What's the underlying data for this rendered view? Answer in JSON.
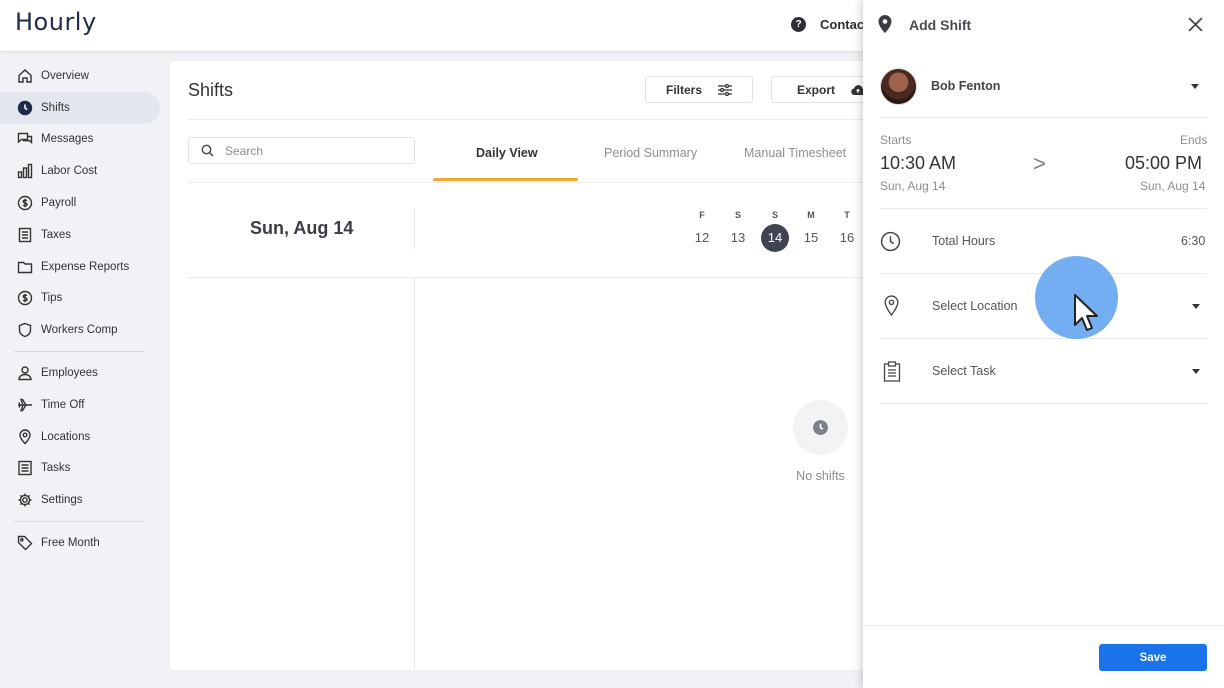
{
  "app": {
    "logo": "Hourly"
  },
  "topbar": {
    "help_icon": "?",
    "contact_label": "Contact"
  },
  "sidebar": {
    "items": [
      {
        "label": "Overview",
        "icon": "home-icon"
      },
      {
        "label": "Shifts",
        "icon": "clock-icon",
        "active": true
      },
      {
        "label": "Messages",
        "icon": "chat-icon"
      },
      {
        "label": "Labor Cost",
        "icon": "bar-chart-icon"
      },
      {
        "label": "Payroll",
        "icon": "dollar-icon"
      },
      {
        "label": "Taxes",
        "icon": "document-icon"
      },
      {
        "label": "Expense Reports",
        "icon": "folder-icon"
      },
      {
        "label": "Tips",
        "icon": "dollar-icon"
      },
      {
        "label": "Workers Comp",
        "icon": "shield-icon"
      },
      {
        "label": "Employees",
        "icon": "person-icon"
      },
      {
        "label": "Time Off",
        "icon": "plane-icon"
      },
      {
        "label": "Locations",
        "icon": "pin-icon"
      },
      {
        "label": "Tasks",
        "icon": "list-icon"
      },
      {
        "label": "Settings",
        "icon": "gear-icon"
      },
      {
        "label": "Free Month",
        "icon": "tag-icon"
      }
    ]
  },
  "main": {
    "title": "Shifts",
    "filters_label": "Filters",
    "export_label": "Export",
    "search_placeholder": "Search",
    "tabs": [
      {
        "label": "Daily View",
        "active": true
      },
      {
        "label": "Period Summary"
      },
      {
        "label": "Manual Timesheet"
      }
    ],
    "selected_date": "Sun, Aug 14",
    "week_days": [
      {
        "letter": "F",
        "num": "12"
      },
      {
        "letter": "S",
        "num": "13"
      },
      {
        "letter": "S",
        "num": "14",
        "selected": true
      },
      {
        "letter": "M",
        "num": "15"
      },
      {
        "letter": "T",
        "num": "16"
      }
    ],
    "empty_text": "No shifts"
  },
  "drawer": {
    "title": "Add Shift",
    "employee": "Bob Fenton",
    "starts_label": "Starts",
    "ends_label": "Ends",
    "start_time": "10:30 AM",
    "end_time": "05:00 PM",
    "start_date": "Sun, Aug 14",
    "end_date": "Sun, Aug 14",
    "arrow": ">",
    "total_hours_label": "Total Hours",
    "total_hours_value": "6:30",
    "location_label": "Select Location",
    "task_label": "Select Task",
    "save_label": "Save"
  },
  "colors": {
    "accent": "#1a73e8",
    "tab_underline": "#f0a932",
    "selected_day": "#3e4450"
  }
}
